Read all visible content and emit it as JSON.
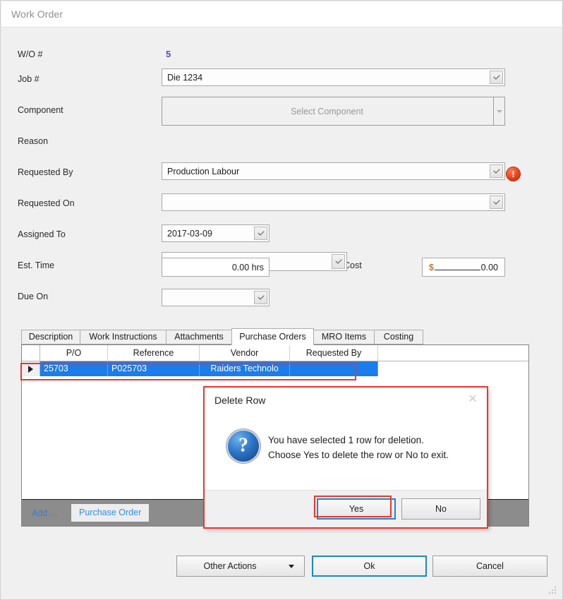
{
  "window": {
    "title": "Work Order"
  },
  "form": {
    "fields": [
      {
        "label": "W/O #",
        "value": "5",
        "placeholder": ""
      },
      {
        "label": "Job #",
        "value": "Die 1234",
        "placeholder": ""
      },
      {
        "label": "Component",
        "value": "",
        "placeholder": "Select Component"
      },
      {
        "label": "Reason",
        "value": "Production Labour",
        "placeholder": ""
      },
      {
        "label": "Requested By",
        "value": "",
        "placeholder": ""
      },
      {
        "label": "Requested On",
        "value": "2017-03-09",
        "placeholder": ""
      },
      {
        "label": "Assigned To",
        "value": "",
        "placeholder": ""
      },
      {
        "label": "Est. Time",
        "value": "0.00 hrs",
        "placeholder": ""
      },
      {
        "label": "Est. Cost",
        "value": "0.00",
        "currency": "$"
      },
      {
        "label": "Due On",
        "value": "",
        "placeholder": ""
      }
    ],
    "validation_icon": "error-icon",
    "validation_glyph": "!"
  },
  "tabs": [
    {
      "label": "Description",
      "active": false
    },
    {
      "label": "Work Instructions",
      "active": false
    },
    {
      "label": "Attachments",
      "active": false
    },
    {
      "label": "Purchase Orders",
      "active": true
    },
    {
      "label": "MRO Items",
      "active": false
    },
    {
      "label": "Costing",
      "active": false
    }
  ],
  "grid": {
    "columns": [
      "P/O",
      "Reference",
      "Vendor",
      "Requested By"
    ],
    "rows": [
      {
        "selected": true,
        "cells": [
          "25703",
          "P025703",
          "Raiders Technolo",
          ""
        ]
      }
    ],
    "toolbar": {
      "add_label": "Add ...",
      "add_button": "Purchase Order"
    }
  },
  "footer": {
    "other_actions": "Other Actions",
    "ok": "Ok",
    "cancel": "Cancel"
  },
  "dialog": {
    "title": "Delete Row",
    "close_icon": "close-icon",
    "close_glyph": "✕",
    "icon": "question-icon",
    "icon_glyph": "?",
    "message_line1": "You have selected 1 row for deletion.",
    "message_line2": "Choose Yes to delete the row or No to exit.",
    "yes": "Yes",
    "no": "No"
  },
  "colors": {
    "accent_blue": "#1b85d6",
    "selection_blue": "#1b7ceb",
    "annotation_red": "#f0342b",
    "error_red": "#e8401c",
    "link_blue": "#2f8ef0",
    "wo_number": "#4a4ae0"
  }
}
